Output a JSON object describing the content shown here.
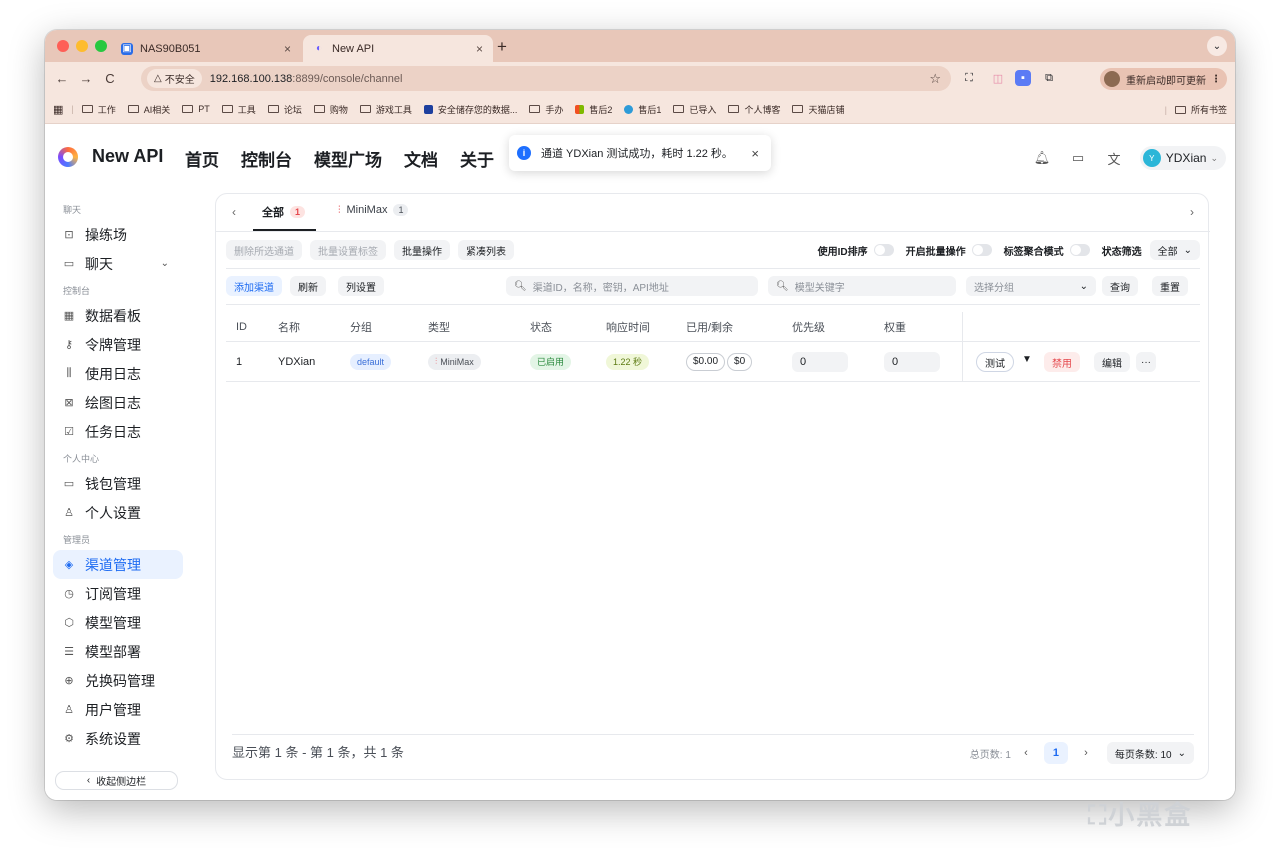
{
  "browser": {
    "tabs": [
      {
        "title": "NAS90B051",
        "close": "×"
      },
      {
        "title": "New API",
        "close": "×"
      }
    ],
    "new_tab": "+",
    "menu_arrow": "⌄",
    "nav": {
      "back": "←",
      "forward": "→",
      "reload": "C"
    },
    "security_label": "不安全",
    "url_host": "192.168.100.138",
    "url_path": ":8899/console/channel",
    "update_label": "重新启动即可更新",
    "bookmarks": [
      "工作",
      "AI相关",
      "PT",
      "工具",
      "论坛",
      "购物",
      "游戏工具",
      "安全储存您的数据...",
      "手办",
      "售后2",
      "售后1",
      "已导入",
      "个人博客",
      "天猫店铺"
    ],
    "all_bookmarks": "所有书签"
  },
  "header": {
    "brand": "New API",
    "nav": [
      "首页",
      "控制台",
      "模型广场",
      "文档",
      "关于"
    ],
    "toast": "通道 YDXian 测试成功，耗时 1.22 秒。",
    "toast_close": "×",
    "user": "YDXian",
    "user_initial": "Y"
  },
  "sidebar": {
    "groups": [
      {
        "title": "聊天",
        "items": [
          {
            "label": "操练场",
            "icon": "monitor-icon"
          },
          {
            "label": "聊天",
            "icon": "chat-icon"
          }
        ]
      },
      {
        "title": "控制台",
        "items": [
          {
            "label": "数据看板",
            "icon": "grid-icon"
          },
          {
            "label": "令牌管理",
            "icon": "key-icon"
          },
          {
            "label": "使用日志",
            "icon": "bar-chart-icon"
          },
          {
            "label": "绘图日志",
            "icon": "image-icon"
          },
          {
            "label": "任务日志",
            "icon": "checkbox-icon"
          }
        ]
      },
      {
        "title": "个人中心",
        "items": [
          {
            "label": "钱包管理",
            "icon": "wallet-icon"
          },
          {
            "label": "个人设置",
            "icon": "user-icon"
          }
        ]
      },
      {
        "title": "管理员",
        "items": [
          {
            "label": "渠道管理",
            "icon": "layers-icon"
          },
          {
            "label": "订阅管理",
            "icon": "subscription-icon"
          },
          {
            "label": "模型管理",
            "icon": "cube-icon"
          },
          {
            "label": "模型部署",
            "icon": "server-icon"
          },
          {
            "label": "兑换码管理",
            "icon": "gift-icon"
          },
          {
            "label": "用户管理",
            "icon": "user-icon"
          },
          {
            "label": "系统设置",
            "icon": "settings-icon"
          }
        ]
      }
    ],
    "collapse": "收起侧边栏"
  },
  "channel": {
    "tabs": [
      {
        "label": "全部",
        "count": "1"
      },
      {
        "label": "MiniMax",
        "count": "1"
      }
    ],
    "row1": {
      "delete_selected": "删除所选通道",
      "batch_tag": "批量设置标签",
      "batch_op": "批量操作",
      "compact": "紧凑列表",
      "use_id_sort": "使用ID排序",
      "enable_batch": "开启批量操作",
      "tag_aggregate": "标签聚合模式",
      "status_filter": "状态筛选",
      "status_value": "全部"
    },
    "row2": {
      "add": "添加渠道",
      "refresh": "刷新",
      "columns": "列设置",
      "search_placeholder": "渠道ID，名称，密钥，API地址",
      "model_placeholder": "模型关键字",
      "group_placeholder": "选择分组",
      "query": "查询",
      "reset": "重置"
    },
    "columns": [
      "ID",
      "名称",
      "分组",
      "类型",
      "状态",
      "响应时间",
      "已用/剩余",
      "优先级",
      "权重"
    ],
    "rows": [
      {
        "id": "1",
        "name": "YDXian",
        "group": "default",
        "type": "MiniMax",
        "status": "已启用",
        "response": "1.22 秒",
        "used": "$0.00",
        "remain": "$0",
        "priority": "0",
        "weight": "0"
      }
    ],
    "actions": {
      "test": "测试",
      "disable": "禁用",
      "edit": "编辑",
      "more": "···"
    },
    "footer": {
      "summary": "显示第 1 条 - 第 1 条，共 1 条",
      "total": "总页数: 1",
      "page": "1",
      "page_size": "每页条数: 10"
    }
  },
  "watermark": "小黑盒",
  "colors": {
    "accent": "#1d6bf2",
    "tabstrip": "#e8c7b9",
    "toolbar": "#f6e6de",
    "danger": "#e5484d"
  }
}
